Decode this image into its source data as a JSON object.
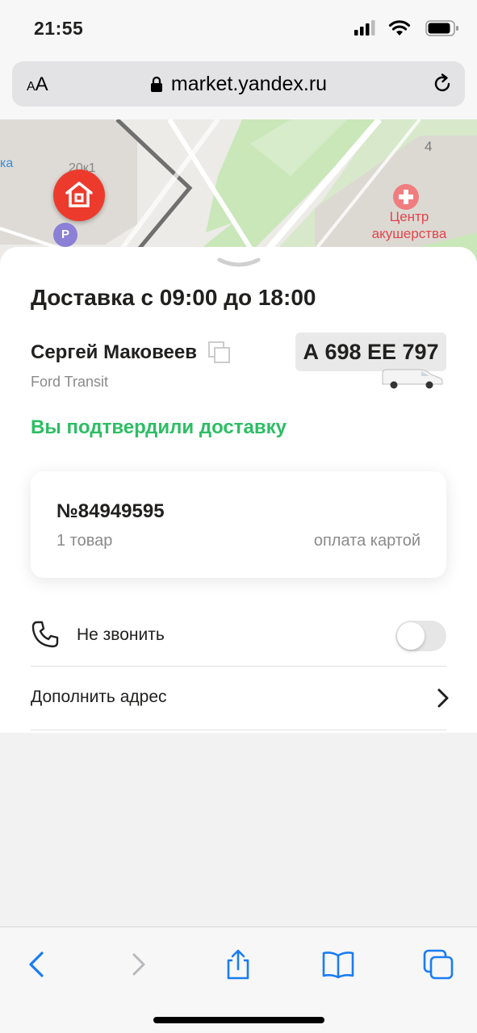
{
  "status_bar": {
    "time": "21:55"
  },
  "browser": {
    "text_size_label_small": "A",
    "text_size_label_large": "A",
    "url": "market.yandex.ru"
  },
  "map": {
    "labels": {
      "tsentr": "Центр акушерства",
      "ka": "ка",
      "building_number": "20к1",
      "house": "4"
    },
    "parking_icon_label": "P"
  },
  "delivery": {
    "title": "Доставка с 09:00 до 18:00",
    "courier_name": "Сергей Маковеев",
    "vehicle_model": "Ford Transit",
    "plate": "А 698 ЕЕ 797",
    "status": "Вы подтвердили доставку"
  },
  "order": {
    "number": "№84949595",
    "items": "1 товар",
    "payment": "оплата картой"
  },
  "options": {
    "no_call_label": "Не звонить",
    "no_call_enabled": false,
    "add_address_label": "Дополнить адрес"
  },
  "colors": {
    "accent_green": "#2dbe64",
    "pin_red": "#ec3b2d",
    "ios_blue": "#1a7cf4"
  },
  "icons": [
    "signal-icon",
    "wifi-icon",
    "battery-icon",
    "lock-icon",
    "reload-icon",
    "home-pin-icon",
    "parking-icon",
    "medical-icon",
    "copy-icon",
    "van-icon",
    "phone-icon",
    "chevron-right-icon",
    "back-icon",
    "forward-icon",
    "share-icon",
    "bookmarks-icon",
    "tabs-icon"
  ]
}
